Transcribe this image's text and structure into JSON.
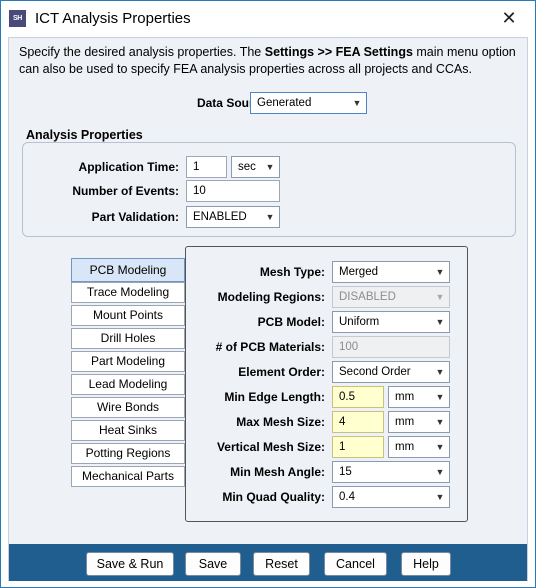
{
  "window": {
    "title": "ICT Analysis Properties",
    "app_icon_text": "SH",
    "close_glyph": "✕"
  },
  "description": {
    "part1": "Specify the desired analysis properties. The ",
    "bold": "Settings >> FEA Settings",
    "part2": " main menu option can also be used to specify FEA analysis properties across all projects and CCAs."
  },
  "data_source": {
    "label": "Data Source:",
    "value": "Generated"
  },
  "analysis_properties": {
    "title": "Analysis Properties",
    "application_time": {
      "label": "Application Time:",
      "value": "1",
      "unit": "sec"
    },
    "number_of_events": {
      "label": "Number of Events:",
      "value": "10"
    },
    "part_validation": {
      "label": "Part Validation:",
      "value": "ENABLED"
    }
  },
  "tabs": [
    "PCB Modeling",
    "Trace Modeling",
    "Mount Points",
    "Drill Holes",
    "Part Modeling",
    "Lead Modeling",
    "Wire Bonds",
    "Heat Sinks",
    "Potting Regions",
    "Mechanical Parts"
  ],
  "pcb_modeling": {
    "mesh_type": {
      "label": "Mesh Type:",
      "value": "Merged"
    },
    "modeling_regions": {
      "label": "Modeling Regions:",
      "value": "DISABLED"
    },
    "pcb_model": {
      "label": "PCB Model:",
      "value": "Uniform"
    },
    "pcb_materials": {
      "label": "# of PCB Materials:",
      "value": "100"
    },
    "element_order": {
      "label": "Element Order:",
      "value": "Second Order"
    },
    "min_edge_length": {
      "label": "Min Edge Length:",
      "value": "0.5",
      "unit": "mm"
    },
    "max_mesh_size": {
      "label": "Max Mesh Size:",
      "value": "4",
      "unit": "mm"
    },
    "vertical_mesh_size": {
      "label": "Vertical Mesh Size:",
      "value": "1",
      "unit": "mm"
    },
    "min_mesh_angle": {
      "label": "Min Mesh Angle:",
      "value": "15"
    },
    "min_quad_quality": {
      "label": "Min Quad Quality:",
      "value": "0.4"
    }
  },
  "buttons": {
    "save_run": "Save & Run",
    "save": "Save",
    "reset": "Reset",
    "cancel": "Cancel",
    "help": "Help"
  },
  "colors": {
    "accent": "#1f5e8f",
    "tab_active": "#d8e6f7",
    "highlight_input": "#ffffd0"
  }
}
